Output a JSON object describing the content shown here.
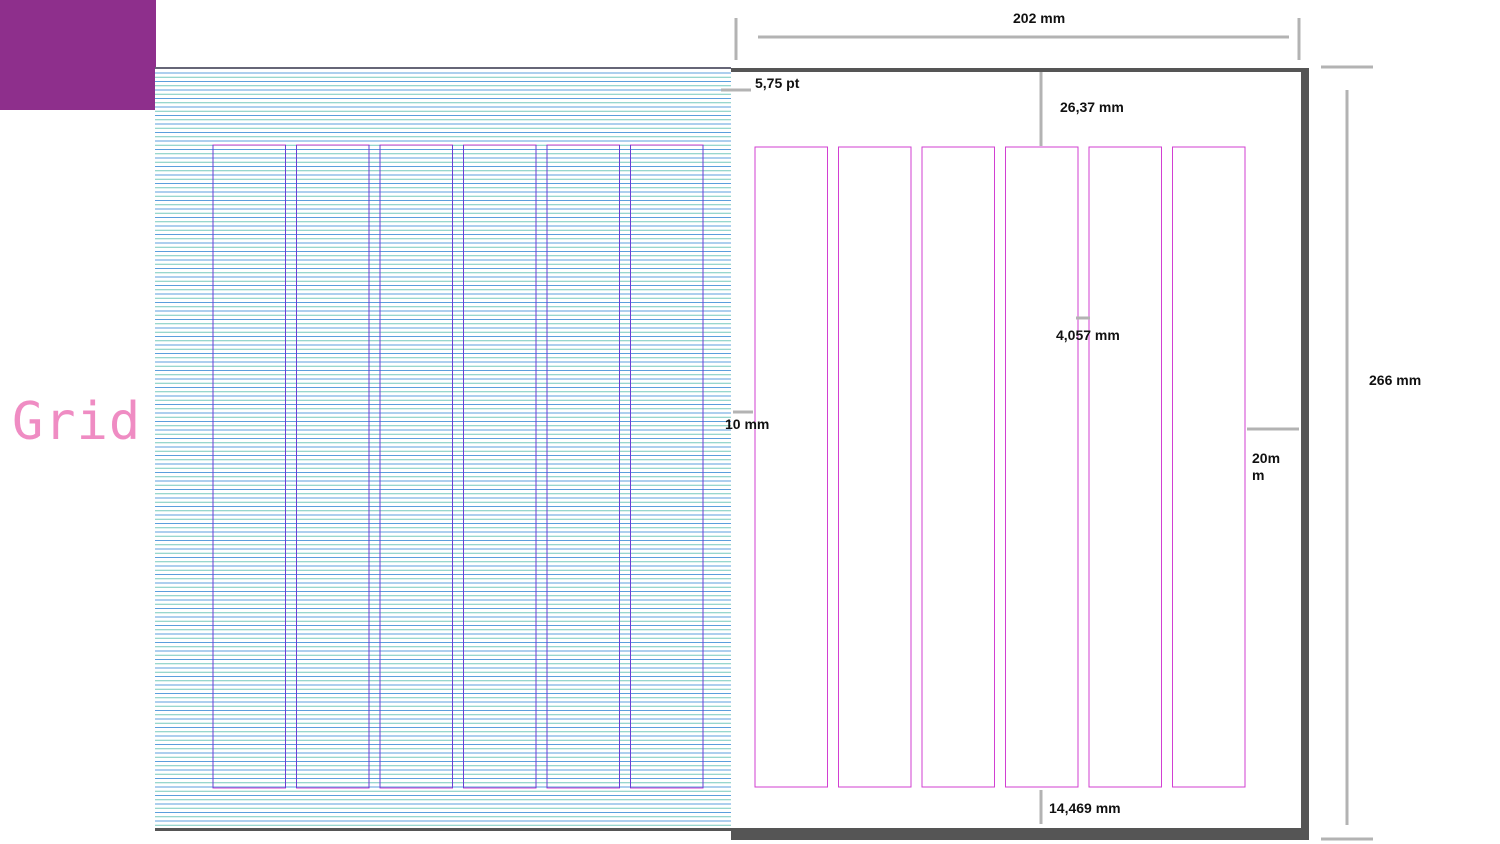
{
  "title": "Grid",
  "colors": {
    "accent_block": "#8e2f8c",
    "title_pink": "#ef8cc3",
    "baseline_blue": "#3f8fd6",
    "baseline_teal": "#5fbfb3",
    "column_guide_magenta": "#d23fd2",
    "column_guide_purple": "#6b3fd6",
    "dimension_gray": "#b3b3b3",
    "page_shadow": "#555555"
  },
  "dimensions": {
    "page_width": "202 mm",
    "page_height": "266 mm",
    "top_margin": "26,37 mm",
    "bottom_margin": "14,469 mm",
    "inner_margin": "10 mm",
    "outer_margin": "20m m",
    "gutter": "4,057 mm",
    "baseline": "5,75 pt"
  },
  "grid": {
    "columns": 6
  }
}
